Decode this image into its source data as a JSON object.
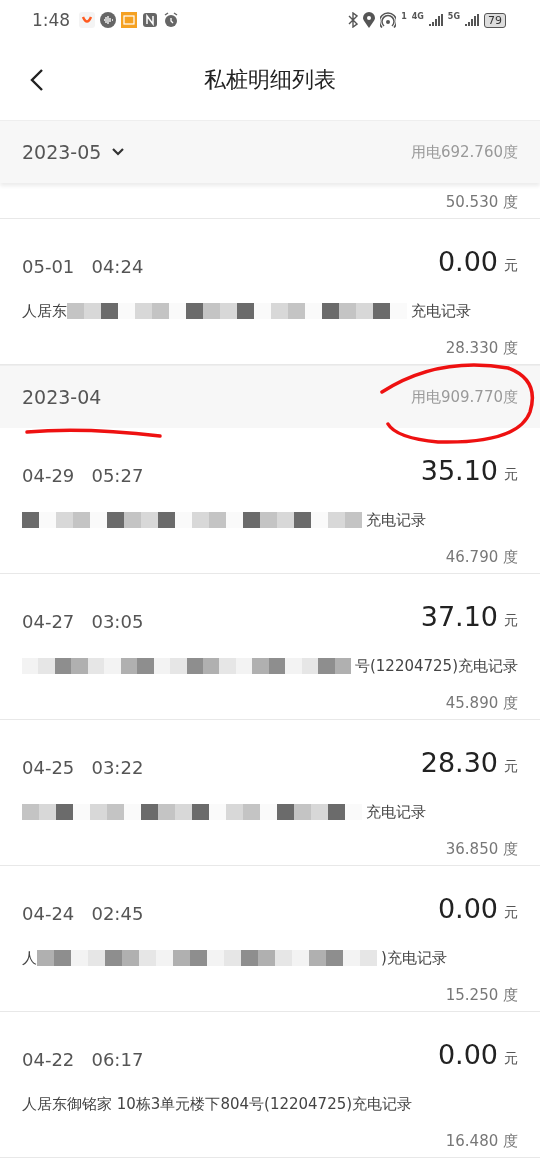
{
  "status_bar": {
    "time": "1:48",
    "sim1": "1",
    "net1": "4G",
    "net2": "5G",
    "battery": "79"
  },
  "header": {
    "title": "私桩明细列表"
  },
  "months": [
    {
      "month": "2023-05",
      "dropdown": true,
      "total": "用电692.760度",
      "records": [
        {
          "kind": "partial",
          "kwh": "50.530",
          "kwh_unit": "度"
        },
        {
          "kind": "full",
          "date": "05-01",
          "time": "04:24",
          "amount": "0.00",
          "currency": "元",
          "prefix": "人居东",
          "suffix": "充电记录",
          "redacted": true,
          "kwh": "28.330",
          "kwh_unit": "度"
        }
      ]
    },
    {
      "month": "2023-04",
      "dropdown": false,
      "total": "用电909.770度",
      "records": [
        {
          "kind": "full",
          "date": "04-29",
          "time": "05:27",
          "amount": "35.10",
          "currency": "元",
          "suffix": "充电记录",
          "redacted": true,
          "kwh": "46.790",
          "kwh_unit": "度"
        },
        {
          "kind": "full",
          "date": "04-27",
          "time": "03:05",
          "amount": "37.10",
          "currency": "元",
          "suffix": "号(12204725)充电记录",
          "redacted": true,
          "kwh": "45.890",
          "kwh_unit": "度"
        },
        {
          "kind": "full",
          "date": "04-25",
          "time": "03:22",
          "amount": "28.30",
          "currency": "元",
          "suffix": "充电记录",
          "redacted": true,
          "kwh": "36.850",
          "kwh_unit": "度"
        },
        {
          "kind": "full",
          "date": "04-24",
          "time": "02:45",
          "amount": "0.00",
          "currency": "元",
          "prefix": "人",
          "suffix": ")充电记录",
          "redacted": true,
          "kwh": "15.250",
          "kwh_unit": "度"
        },
        {
          "kind": "full",
          "date": "04-22",
          "time": "06:17",
          "amount": "0.00",
          "currency": "元",
          "suffix": "人居东御铭家 10栋3单元楼下804号(12204725)充电记录",
          "redacted": false,
          "kwh": "16.480",
          "kwh_unit": "度"
        }
      ]
    }
  ]
}
